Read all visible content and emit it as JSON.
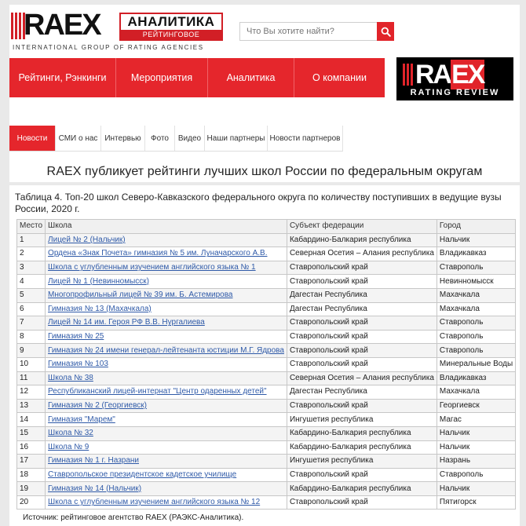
{
  "header": {
    "logo": {
      "word": "RAEX",
      "box_top": "АНАЛИТИКА",
      "box_bottom": "РЕЙТИНГОВОЕ АГЕНТСТВО",
      "tagline": "INTERNATIONAL GROUP OF RATING AGENCIES"
    },
    "search": {
      "placeholder": "Что Вы хотите найти?"
    },
    "nav": [
      {
        "label": "Рейтинги, Рэнкинги"
      },
      {
        "label": "Мероприятия"
      },
      {
        "label": "Аналитика"
      },
      {
        "label": "О компании"
      }
    ],
    "review_logo": {
      "word_a": "RA",
      "word_b": "EX",
      "sub": "RATING REVIEW"
    },
    "subnav": [
      {
        "label": "Новости",
        "active": true
      },
      {
        "label": "СМИ о нас"
      },
      {
        "label": "Интервью"
      },
      {
        "label": "Фото"
      },
      {
        "label": "Видео"
      },
      {
        "label": "Наши партнеры"
      },
      {
        "label": "Новости партнеров"
      }
    ],
    "headline": "RAEX публикует рейтинги лучших школ России по федеральным округам"
  },
  "colors": {
    "accent": "#e5262c",
    "link": "#2f5aa8"
  },
  "table": {
    "caption": "Таблица 4. Топ-20 школ Северо-Кавказского федерального округа по количеству поступивших в ведущие вузы России, 2020 г.",
    "columns": [
      "Место",
      "Школа",
      "Субъект федерации",
      "Город"
    ],
    "rows": [
      [
        "1",
        "Лицей № 2 (Нальчик)",
        "Кабардино-Балкария республика",
        "Нальчик"
      ],
      [
        "2",
        "Ордена «Знак Почета» гимназия № 5 им. Луначарского А.В.",
        "Северная Осетия – Алания республика",
        "Владикавказ"
      ],
      [
        "3",
        "Школа с углубленным изучением английского языка № 1",
        "Ставропольский край",
        "Ставрополь"
      ],
      [
        "4",
        "Лицей № 1 (Невинномысск)",
        "Ставропольский край",
        "Невинномысск"
      ],
      [
        "5",
        "Многопрофильный лицей № 39 им. Б. Астемирова",
        "Дагестан Республика",
        "Махачкала"
      ],
      [
        "6",
        "Гимназия № 13 (Махачкала)",
        "Дагестан Республика",
        "Махачкала"
      ],
      [
        "7",
        "Лицей № 14 им. Героя РФ В.В. Нургалиева",
        "Ставропольский край",
        "Ставрополь"
      ],
      [
        "8",
        "Гимназия № 25",
        "Ставропольский край",
        "Ставрополь"
      ],
      [
        "9",
        "Гимназия № 24 имени генерал-лейтенанта юстиции М.Г. Ядрова",
        "Ставропольский край",
        "Ставрополь"
      ],
      [
        "10",
        "Гимназия № 103",
        "Ставропольский край",
        "Минеральные Воды"
      ],
      [
        "11",
        "Школа № 38",
        "Северная Осетия – Алания республика",
        "Владикавказ"
      ],
      [
        "12",
        "Республиканский лицей-интернат \"Центр одаренных детей\"",
        "Дагестан Республика",
        "Махачкала"
      ],
      [
        "13",
        "Гимназия № 2 (Георгиевск)",
        "Ставропольский край",
        "Георгиевск"
      ],
      [
        "14",
        "Гимназия \"Марем\"",
        "Ингушетия республика",
        "Магас"
      ],
      [
        "15",
        "Школа № 32",
        "Кабардино-Балкария республика",
        "Нальчик"
      ],
      [
        "16",
        "Школа № 9",
        "Кабардино-Балкария республика",
        "Нальчик"
      ],
      [
        "17",
        "Гимназия № 1 г. Назрани",
        "Ингушетия республика",
        "Назрань"
      ],
      [
        "18",
        "Ставропольское президентское кадетское училище",
        "Ставропольский край",
        "Ставрополь"
      ],
      [
        "19",
        "Гимназия № 14 (Нальчик)",
        "Кабардино-Балкария республика",
        "Нальчик"
      ],
      [
        "20",
        "Школа с углубленным изучением английского языка № 12",
        "Ставропольский край",
        "Пятигорск"
      ]
    ],
    "source": "Источник: рейтинговое агентство RAEX (РАЭКС-Аналитика)."
  }
}
